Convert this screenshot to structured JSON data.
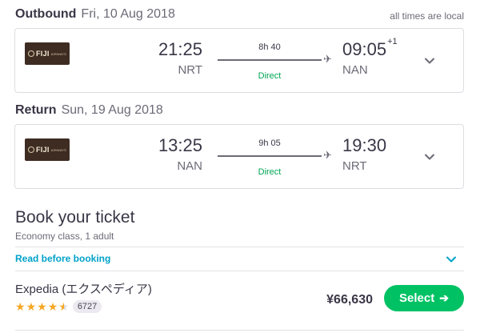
{
  "outbound": {
    "kind": "Outbound",
    "date": "Fri, 10 Aug 2018",
    "airline_logo": {
      "text": "FIJI",
      "sub": "AIRWAYS"
    },
    "dep_time": "21:25",
    "dep_code": "NRT",
    "arr_time": "09:05",
    "arr_day_offset": "+1",
    "arr_code": "NAN",
    "duration": "8h 40",
    "stops": "Direct"
  },
  "tz_note": "all times are local",
  "return": {
    "kind": "Return",
    "date": "Sun, 19 Aug 2018",
    "airline_logo": {
      "text": "FIJI",
      "sub": "AIRWAYS"
    },
    "dep_time": "13:25",
    "dep_code": "NAN",
    "arr_time": "19:30",
    "arr_code": "NRT",
    "duration": "9h 05",
    "stops": "Direct"
  },
  "booking": {
    "title": "Book your ticket",
    "subtitle": "Economy class, 1 adult",
    "read_link": "Read before booking",
    "provider": "Expedia (エクスペディア)",
    "rating": 4.5,
    "review_count": "6727",
    "price": "¥66,630",
    "select_label": "Select"
  },
  "colors": {
    "accent_green": "#00c264",
    "direct_green": "#00a653",
    "link_blue": "#00a2c9",
    "star": "#f6a723"
  },
  "icons": {
    "plane": "plane-icon",
    "chevron": "chevron-down-icon",
    "arrow": "arrow-right-icon"
  }
}
